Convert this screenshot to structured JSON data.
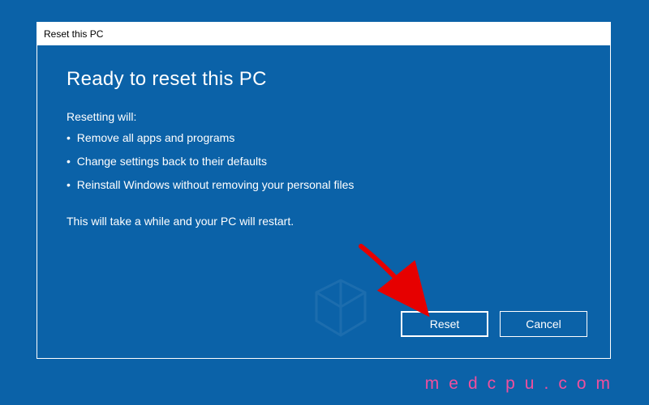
{
  "dialog": {
    "titlebar": "Reset this PC",
    "heading": "Ready to reset this PC",
    "subheading": "Resetting will:",
    "bullets": [
      "Remove all apps and programs",
      "Change settings back to their defaults",
      "Reinstall Windows without removing your personal files"
    ],
    "note": "This will take a while and your PC will restart.",
    "buttons": {
      "reset": "Reset",
      "cancel": "Cancel"
    }
  },
  "annotation": {
    "arrow_color": "#e60000"
  },
  "watermark": {
    "footer": "medcpu.com"
  }
}
